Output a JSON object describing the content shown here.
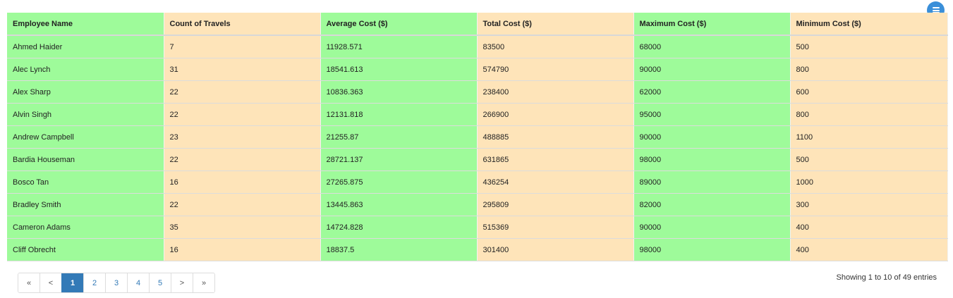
{
  "table": {
    "columns": [
      "Employee Name",
      "Count of Travels",
      "Average Cost ($)",
      "Total Cost ($)",
      "Maximum Cost ($)",
      "Minimum Cost ($)"
    ],
    "rows": [
      [
        "Ahmed Haider",
        "7",
        "11928.571",
        "83500",
        "68000",
        "500"
      ],
      [
        "Alec Lynch",
        "31",
        "18541.613",
        "574790",
        "90000",
        "800"
      ],
      [
        "Alex Sharp",
        "22",
        "10836.363",
        "238400",
        "62000",
        "600"
      ],
      [
        "Alvin Singh",
        "22",
        "12131.818",
        "266900",
        "95000",
        "800"
      ],
      [
        "Andrew Campbell",
        "23",
        "21255.87",
        "488885",
        "90000",
        "1100"
      ],
      [
        "Bardia Houseman",
        "22",
        "28721.137",
        "631865",
        "98000",
        "500"
      ],
      [
        "Bosco Tan",
        "16",
        "27265.875",
        "436254",
        "89000",
        "1000"
      ],
      [
        "Bradley Smith",
        "22",
        "13445.863",
        "295809",
        "82000",
        "300"
      ],
      [
        "Cameron Adams",
        "35",
        "14724.828",
        "515369",
        "90000",
        "400"
      ],
      [
        "Cliff Obrecht",
        "16",
        "18837.5",
        "301400",
        "98000",
        "400"
      ]
    ]
  },
  "pagination": {
    "first": "«",
    "prev": "<",
    "pages": [
      "1",
      "2",
      "3",
      "4",
      "5"
    ],
    "next": ">",
    "last": "»",
    "current": "1"
  },
  "info": "Showing 1 to 10 of 49 entries",
  "menu_icon": "hamburger-menu-icon",
  "colors": {
    "green_column": "#9efb9a",
    "orange_column": "#fee4b9",
    "active_page": "#337ab7",
    "menu_button": "#3a8fd9"
  }
}
